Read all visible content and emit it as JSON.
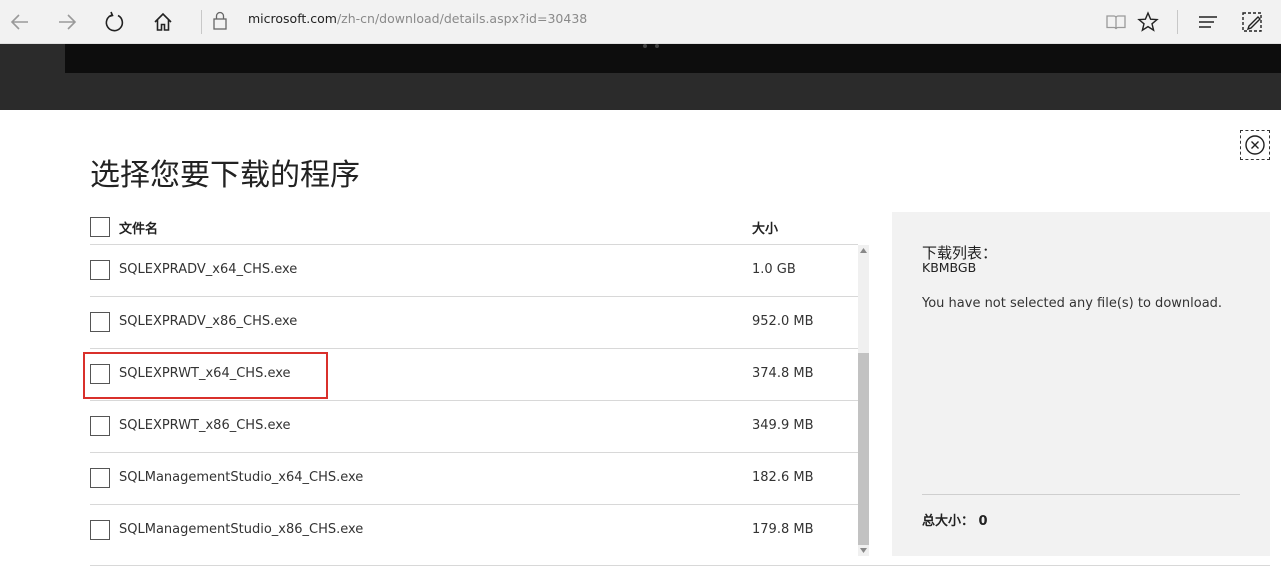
{
  "browser": {
    "url_host": "microsoft.com",
    "url_path": "/zh-cn/download/details.aspx?id=30438",
    "icons": {
      "back": "arrow-left-icon",
      "forward": "arrow-right-icon",
      "refresh": "refresh-icon",
      "home": "home-icon",
      "lock": "lock-icon",
      "reading_view": "book-icon",
      "favorite": "star-icon",
      "hub": "hub-icon",
      "web_note": "web-note-icon"
    }
  },
  "dialog": {
    "title": "选择您要下载的程序",
    "close_icon": "close-circle-icon",
    "header": {
      "name_label": "文件名",
      "size_label": "大小"
    },
    "files": [
      {
        "name": "SQLEXPRADV_x64_CHS.exe",
        "size": "1.0 GB"
      },
      {
        "name": "SQLEXPRADV_x86_CHS.exe",
        "size": "952.0 MB"
      },
      {
        "name": "SQLEXPRWT_x64_CHS.exe",
        "size": "374.8 MB"
      },
      {
        "name": "SQLEXPRWT_x86_CHS.exe",
        "size": "349.9 MB"
      },
      {
        "name": "SQLManagementStudio_x64_CHS.exe",
        "size": "182.6 MB"
      },
      {
        "name": "SQLManagementStudio_x86_CHS.exe",
        "size": "179.8 MB"
      }
    ],
    "highlight_color": "#d9302b",
    "summary": {
      "title": "下载列表：",
      "subtitle": "KBMBGB",
      "message": "You have not selected any file(s) to download.",
      "total_label": "总大小：",
      "total_value": "0"
    }
  }
}
